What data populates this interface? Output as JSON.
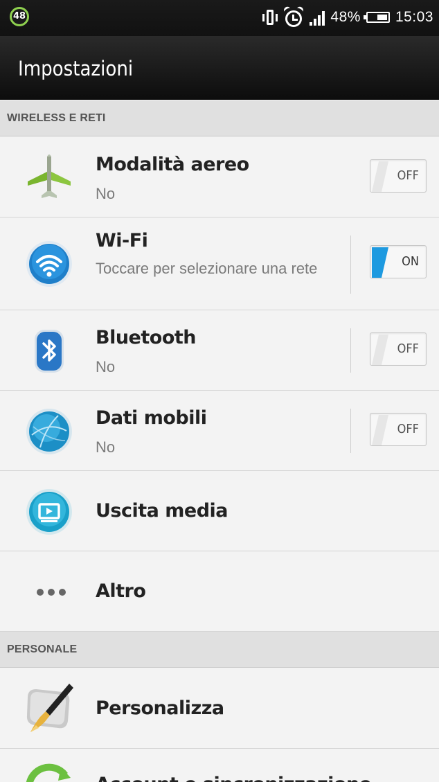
{
  "status_bar": {
    "badge": "48",
    "battery_percent": "48%",
    "time": "15:03",
    "icons": [
      "vibrate-icon",
      "alarm-icon",
      "signal-icon",
      "battery-icon"
    ]
  },
  "header": {
    "title": "Impostazioni"
  },
  "sections": {
    "wireless": "WIRELESS E RETI",
    "personal": "PERSONALE"
  },
  "rows": {
    "airplane": {
      "label": "Modalità aereo",
      "sub": "No",
      "toggle": "OFF",
      "icon": "airplane-icon"
    },
    "wifi": {
      "label": "Wi-Fi",
      "sub": "Toccare per selezionare una rete",
      "toggle": "ON",
      "icon": "wifi-icon"
    },
    "bluetooth": {
      "label": "Bluetooth",
      "sub": "No",
      "toggle": "OFF",
      "icon": "bluetooth-icon"
    },
    "mobile_data": {
      "label": "Dati mobili",
      "sub": "No",
      "toggle": "OFF",
      "icon": "globe-icon"
    },
    "media_output": {
      "label": "Uscita media",
      "icon": "media-output-icon"
    },
    "more": {
      "label": "Altro",
      "icon": "more-icon"
    },
    "personalize": {
      "label": "Personalizza",
      "icon": "brush-icon"
    },
    "partial": {
      "label": "Account e sincronizzazione",
      "icon": "sync-icon"
    }
  },
  "colors": {
    "accent_blue": "#2a9ad8",
    "toggle_on": "#1e9ae0",
    "green": "#8fd14f"
  }
}
